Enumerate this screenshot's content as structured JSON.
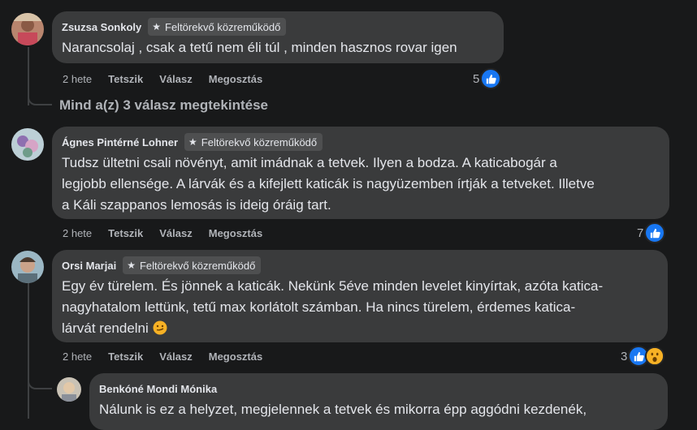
{
  "badge_label": "Feltörekvő közreműködő",
  "action_labels": {
    "time": "2 hete",
    "like": "Tetszik",
    "reply": "Válasz",
    "share": "Megosztás"
  },
  "comments": [
    {
      "author": "Zsuzsa Sonkoly",
      "text": "Narancsolaj , csak a tetű nem éli túl , minden hasznos rovar igen",
      "reactions": "5"
    },
    {
      "author": "Ágnes Pintérné Lohner",
      "text": "Tudsz ültetni csali növényt, amit imádnak a tetvek. Ilyen a bodza. A katicabogár a\nlegjobb ellensége. A lárvák és a kifejlett katicák is nagyüzemben írtják a tetveket. Illetve\na Káli szappanos lemosás is ideig óráig tart.",
      "reactions": "7"
    },
    {
      "author": "Orsi Marjai",
      "text": "Egy év türelem. És jönnek a katicák. Nekünk 5éve minden levelet kinyírtak, azóta katica-\nnagyhatalom lettünk, tetű max korlátolt számban. Ha nincs türelem, érdemes katica-\nlárvát rendelni",
      "reactions": "3"
    }
  ],
  "view_replies": "Mind a(z) 3 válasz megtekintése",
  "reply": {
    "author": "Benkóné Mondi Mónika",
    "text": "Nálunk is ez a helyzet, megjelennek a tetvek és mikorra épp aggódni kezdenék,"
  },
  "icons": {
    "star": "star-icon",
    "like": "like-thumb-icon",
    "wow": "wow-emoji-icon",
    "smirk": "smirk-emoji-icon"
  },
  "colors": {
    "background": "#18191a",
    "bubble": "#3a3b3c",
    "like_blue": "#1877f2",
    "wow_yellow": "#f7b125"
  }
}
